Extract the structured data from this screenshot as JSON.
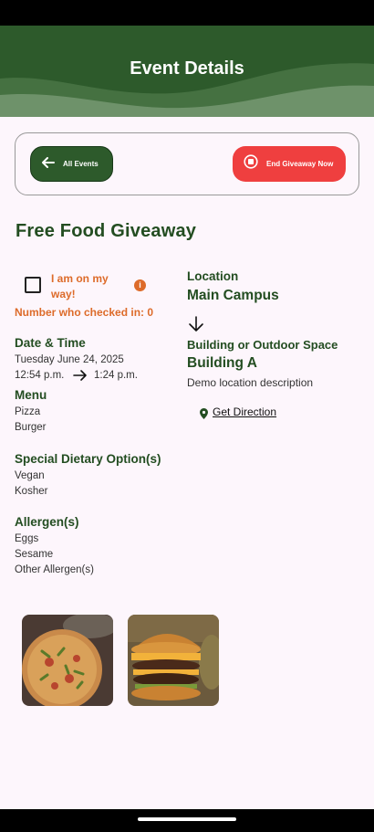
{
  "header": {
    "title": "Event Details"
  },
  "actions": {
    "back_label": "All Events",
    "end_label": "End Giveaway Now"
  },
  "event": {
    "title": "Free Food Giveaway"
  },
  "checkin": {
    "on_my_way_label": "I am on my way!",
    "count_text": "Number who checked in: 0"
  },
  "datetime": {
    "heading": "Date & Time",
    "date": "Tuesday June 24, 2025",
    "start": "12:54 p.m.",
    "end": "1:24 p.m."
  },
  "menu": {
    "heading": "Menu",
    "items": [
      "Pizza",
      "Burger"
    ]
  },
  "dietary": {
    "heading": "Special Dietary Option(s)",
    "items": [
      "Vegan",
      "Kosher"
    ]
  },
  "allergens": {
    "heading": "Allergen(s)",
    "items": [
      "Eggs",
      "Sesame",
      "Other Allergen(s)"
    ]
  },
  "location": {
    "label": "Location",
    "value": "Main Campus",
    "building_label": "Building or Outdoor Space",
    "building_value": "Building A",
    "description": "Demo location description",
    "directions_label": "Get Direction"
  },
  "colors": {
    "primary": "#2d5a2b",
    "danger": "#ef3f3f",
    "accent": "#dd6b2a",
    "background": "#fdf6fc"
  }
}
